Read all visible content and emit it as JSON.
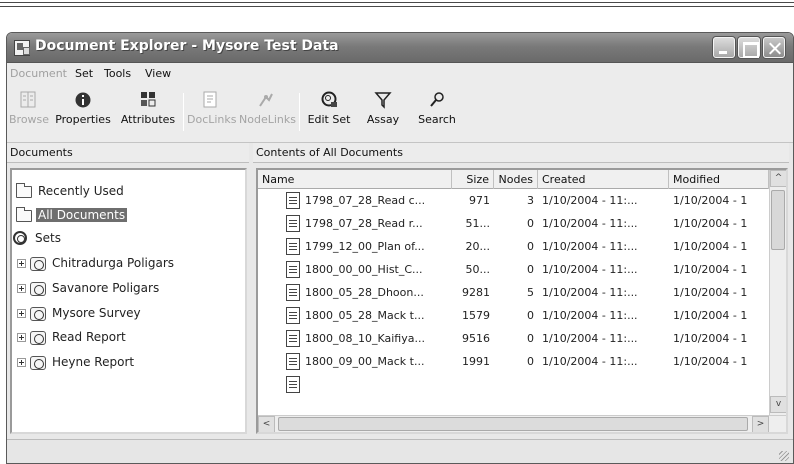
{
  "window": {
    "title": "Document Explorer - Mysore Test Data"
  },
  "menu": [
    "Document",
    "Set",
    "Tools",
    "View"
  ],
  "toolbar": {
    "browse": "Browse",
    "properties": "Properties",
    "attributes": "Attributes",
    "doclinks": "DocLinks",
    "nodelinks": "NodeLinks",
    "edit_set": "Edit Set",
    "assay": "Assay",
    "search": "Search"
  },
  "left": {
    "header": "Documents",
    "tree": [
      {
        "label": "Recently Used",
        "icon": "folder-icon"
      },
      {
        "label": "All Documents",
        "icon": "folder-icon",
        "selected": true
      },
      {
        "label": "Sets",
        "icon": "sets-icon"
      },
      {
        "label": "Chitradurga Poligars",
        "icon": "set-icon"
      },
      {
        "label": "Savanore Poligars",
        "icon": "set-icon"
      },
      {
        "label": "Mysore Survey",
        "icon": "set-icon"
      },
      {
        "label": "Read Report",
        "icon": "set-icon"
      },
      {
        "label": "Heyne Report",
        "icon": "set-icon"
      }
    ]
  },
  "right": {
    "header": "Contents of All Documents",
    "columns": [
      "Name",
      "Size",
      "Nodes",
      "Created",
      "Modified"
    ],
    "rows": [
      {
        "name": "1798_07_28_Read c...",
        "size": "971",
        "nodes": "3",
        "created": "1/10/2004 - 11:...",
        "modified": "1/10/2004 - 1"
      },
      {
        "name": "1798_07_28_Read r...",
        "size": "51...",
        "nodes": "0",
        "created": "1/10/2004 - 11:...",
        "modified": "1/10/2004 - 1"
      },
      {
        "name": "1799_12_00_Plan of...",
        "size": "20...",
        "nodes": "0",
        "created": "1/10/2004 - 11:...",
        "modified": "1/10/2004 - 1"
      },
      {
        "name": "1800_00_00_Hist_C...",
        "size": "50...",
        "nodes": "0",
        "created": "1/10/2004 - 11:...",
        "modified": "1/10/2004 - 1"
      },
      {
        "name": "1800_05_28_Dhoon...",
        "size": "9281",
        "nodes": "5",
        "created": "1/10/2004 - 11:...",
        "modified": "1/10/2004 - 1"
      },
      {
        "name": "1800_05_28_Mack t...",
        "size": "1579",
        "nodes": "0",
        "created": "1/10/2004 - 11:...",
        "modified": "1/10/2004 - 1"
      },
      {
        "name": "1800_08_10_Kaifiya...",
        "size": "9516",
        "nodes": "0",
        "created": "1/10/2004 - 11:...",
        "modified": "1/10/2004 - 1"
      },
      {
        "name": "1800_09_00_Mack t...",
        "size": "1991",
        "nodes": "0",
        "created": "1/10/2004 - 11:...",
        "modified": "1/10/2004 - 1"
      }
    ]
  },
  "scroll": {
    "up": "^",
    "down": "v",
    "left": "<",
    "right": ">"
  }
}
